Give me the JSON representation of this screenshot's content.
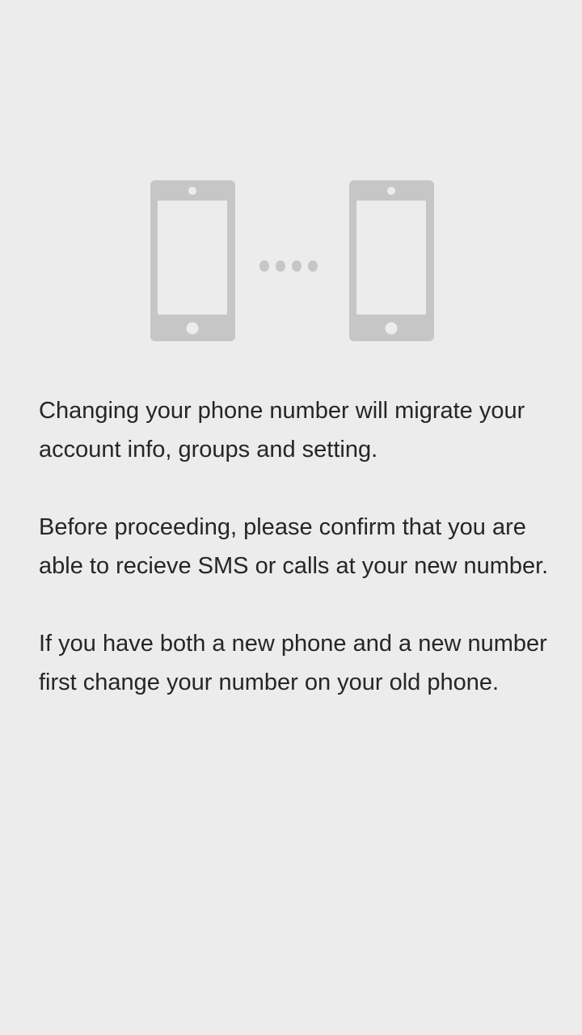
{
  "screen": {
    "background_color": "#ececec",
    "text_color": "#262626",
    "icon_color": "#c6c6c6"
  },
  "illustration": {
    "icon": "phone-transfer-icon"
  },
  "content": {
    "paragraphs": [
      "Changing your phone number will migrate your account info, groups and setting.",
      "Before proceeding, please confirm that you are able to recieve SMS or calls at your new number.",
      "If you have both a new phone and a new number first change your number on your old phone."
    ]
  }
}
